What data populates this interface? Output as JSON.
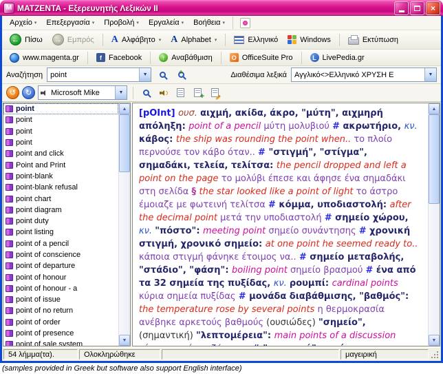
{
  "window": {
    "title": "MATZENTA - Εξερευνητής Λεξικών II"
  },
  "menu": {
    "items": [
      "Αρχείο",
      "Επεξεργασία",
      "Προβολή",
      "Εργαλεία",
      "Βοήθεια"
    ]
  },
  "toolbar": {
    "back": "Πίσω",
    "forward": "Εμπρός",
    "alphabet_gr": "Αλφάβητο",
    "alphabet_en": "Alphabet",
    "greek": "Ελληνικό",
    "windows": "Windows",
    "print": "Εκτύπωση"
  },
  "links": {
    "items": [
      "www.magenta.gr",
      "Facebook",
      "Αναβάθμιση",
      "OfficeSuite Pro",
      "LivePedia.gr"
    ]
  },
  "search": {
    "label": "Αναζήτηση",
    "value": "point"
  },
  "dictionaries": {
    "label": "Διαθέσιμα λεξικά",
    "value": "Αγγλικό<>Ελληνικό ΧΡΥΣΗ Ε"
  },
  "voice": {
    "value": "Microsoft Mike"
  },
  "wordlist": {
    "selected_index": 0,
    "items": [
      "point",
      "point",
      "point",
      "point",
      "point and click",
      "Point and Print",
      "point-blank",
      "point-blank refusal",
      "point chart",
      "point diagram",
      "point duty",
      "point listing",
      "point of a pencil",
      "point of conscience",
      "point of departure",
      "point of honour",
      "point of honour - a",
      "point of issue",
      "point of no return",
      "point of order",
      "point of presence",
      "point of sale system"
    ]
  },
  "entry": {
    "segments": [
      {
        "s": "hw",
        "t": "[pOInt] "
      },
      {
        "s": "pos",
        "t": "ουσ. "
      },
      {
        "s": "gloss",
        "t": "αιχμή, ακίδα, άκρο, \"μύτη\", αιχμηρή απόληξη: "
      },
      {
        "s": "phr",
        "t": "point of a pencil "
      },
      {
        "s": "tr",
        "t": "μύτη μολυβιού "
      },
      {
        "s": "sep",
        "t": "# "
      },
      {
        "s": "gloss",
        "t": "ακρωτήριο, "
      },
      {
        "s": "kv",
        "t": "κν. "
      },
      {
        "s": "gloss",
        "t": "κάβος: "
      },
      {
        "s": "sen",
        "t": "the ship was rounding the point when.. "
      },
      {
        "s": "tr",
        "t": "το πλοίο περνούσε τον κάβο όταν.. "
      },
      {
        "s": "sep",
        "t": "# "
      },
      {
        "s": "gloss",
        "t": "\"στιγμή\", \"στίγμα\", σημαδάκι, τελεία, τελίτσα: "
      },
      {
        "s": "sen",
        "t": "the pencil dropped and left a point on the page "
      },
      {
        "s": "tr",
        "t": "το μολύβι έπεσε και άφησε ένα σημαδάκι στη σελίδα "
      },
      {
        "s": "sect",
        "t": "§ "
      },
      {
        "s": "sen",
        "t": "the star looked like a point of light "
      },
      {
        "s": "tr",
        "t": "το άστρο έμοιαζε με φωτεινή τελίτσα "
      },
      {
        "s": "sep",
        "t": "# "
      },
      {
        "s": "gloss",
        "t": "κόμμα, υποδιαστολή: "
      },
      {
        "s": "sen",
        "t": "after the decimal point "
      },
      {
        "s": "tr",
        "t": "μετά την υποδιαστολή "
      },
      {
        "s": "sep",
        "t": "# "
      },
      {
        "s": "gloss",
        "t": "σημείο χώρου, "
      },
      {
        "s": "kv",
        "t": "κν. "
      },
      {
        "s": "gloss",
        "t": "\"πόστο\": "
      },
      {
        "s": "phr",
        "t": "meeting point "
      },
      {
        "s": "tr",
        "t": "σημείο συνάντησης "
      },
      {
        "s": "sep",
        "t": "# "
      },
      {
        "s": "gloss",
        "t": "χρονική στιγμή, χρονικό σημείο: "
      },
      {
        "s": "sen",
        "t": "at one point he seemed ready to.. "
      },
      {
        "s": "tr",
        "t": "κάποια στιγμή φάνηκε έτοιμος να.. "
      },
      {
        "s": "sep",
        "t": "# "
      },
      {
        "s": "gloss",
        "t": "σημείο μεταβολής, \"στάδιο\", \"φάση\": "
      },
      {
        "s": "phr",
        "t": "boiling point "
      },
      {
        "s": "tr",
        "t": "σημείο βρασμού "
      },
      {
        "s": "sep",
        "t": "# "
      },
      {
        "s": "gloss",
        "t": "ένα από τα 32 σημεία της πυξίδας, "
      },
      {
        "s": "kv",
        "t": "κν. "
      },
      {
        "s": "gloss",
        "t": "ρουμπί: "
      },
      {
        "s": "phr",
        "t": "cardinal points "
      },
      {
        "s": "tr",
        "t": "κύρια σημεία πυξίδας "
      },
      {
        "s": "sep",
        "t": "# "
      },
      {
        "s": "gloss",
        "t": "μονάδα διαβάθμισης, \"βαθμός\": "
      },
      {
        "s": "sen",
        "t": "the temperature rose by several points "
      },
      {
        "s": "tr",
        "t": "η θερμοκρασία ανέβηκε αρκετούς βαθμούς "
      },
      {
        "s": "plain",
        "t": "(ουσιώδες) "
      },
      {
        "s": "gloss",
        "t": "\"σημείο\", "
      },
      {
        "s": "plain",
        "t": "(σημαντική) "
      },
      {
        "s": "gloss",
        "t": "\"λεπτομέρεια\": "
      },
      {
        "s": "phr",
        "t": "main points of a discussion "
      },
      {
        "s": "tr",
        "t": "κύρια σημεία συζήτησης "
      },
      {
        "s": "sep",
        "t": "# "
      },
      {
        "s": "gloss",
        "t": "\"αναφορά\", μνεία,"
      }
    ]
  },
  "status": {
    "count": "54 λήμμα(τα).",
    "state": "Ολοκληρώθηκε",
    "context": "μαγειρική"
  },
  "caption": "(samples provided in Greek but software also support English interface)",
  "icons": {
    "menu_arrow": "▾",
    "combo_arrow": "▼",
    "back_arrow": "←",
    "forward_arrow": "→",
    "upgrade_arrow": "↑",
    "scroll_up": "▲",
    "scroll_down": "▼",
    "undo_arrow": "↺",
    "redo_arrow": "↻",
    "close": "×",
    "facebook_f": "f",
    "alphabet_a": "A",
    "officesuite_o": "O",
    "livepedia_l": "L",
    "logo_m": "M"
  },
  "colors": {
    "titlebar": "#c90680",
    "frame": "#0c49d6",
    "headword": "#1717e0",
    "example_sentence": "#d92a1c",
    "example_phrase": "#cc0f9e",
    "translation": "#7e3fb1"
  }
}
